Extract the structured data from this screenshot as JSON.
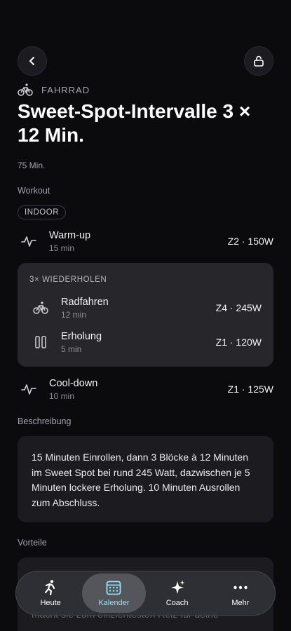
{
  "nav": {
    "back_icon": "chevron-left-icon",
    "lock_icon": "unlock-icon"
  },
  "workout": {
    "sport": "FAHRRAD",
    "title": "Sweet-Spot-Intervalle 3 × 12 Min.",
    "duration": "75 Min."
  },
  "sections": {
    "workout_label": "Workout",
    "environment_tag": "INDOOR",
    "description_label": "Beschreibung",
    "benefits_label": "Vorteile"
  },
  "steps": {
    "warmup": {
      "name": "Warm-up",
      "duration": "15 min",
      "zone": "Z2 · 150W"
    },
    "repeat": {
      "label": "3× WIEDERHOLEN",
      "items": [
        {
          "name": "Radfahren",
          "duration": "12 min",
          "zone": "Z4 · 245W"
        },
        {
          "name": "Erholung",
          "duration": "5 min",
          "zone": "Z1 · 120W"
        }
      ]
    },
    "cooldown": {
      "name": "Cool-down",
      "duration": "10 min",
      "zone": "Z1 · 125W"
    }
  },
  "description": "15 Minuten Einrollen, dann 3 Blöcke à 12 Minuten im Sweet Spot bei rund 245 Watt, dazwischen je 5 Minuten lockere Erholung. 10 Minuten Ausrollen zum Abschluss.",
  "benefits_visible": "macht sie zum effizientesten Reiz für deine",
  "tabbar": {
    "tabs": [
      {
        "label": "Heute",
        "icon": "running-person-icon",
        "active": false
      },
      {
        "label": "Kalender",
        "icon": "calendar-icon",
        "active": true
      },
      {
        "label": "Coach",
        "icon": "sparkles-icon",
        "active": false
      },
      {
        "label": "Mehr",
        "icon": "more-dots-icon",
        "active": false
      }
    ]
  },
  "colors": {
    "background": "#0b0b0d",
    "card": "#26262b",
    "accent": "#8fe3f4"
  }
}
